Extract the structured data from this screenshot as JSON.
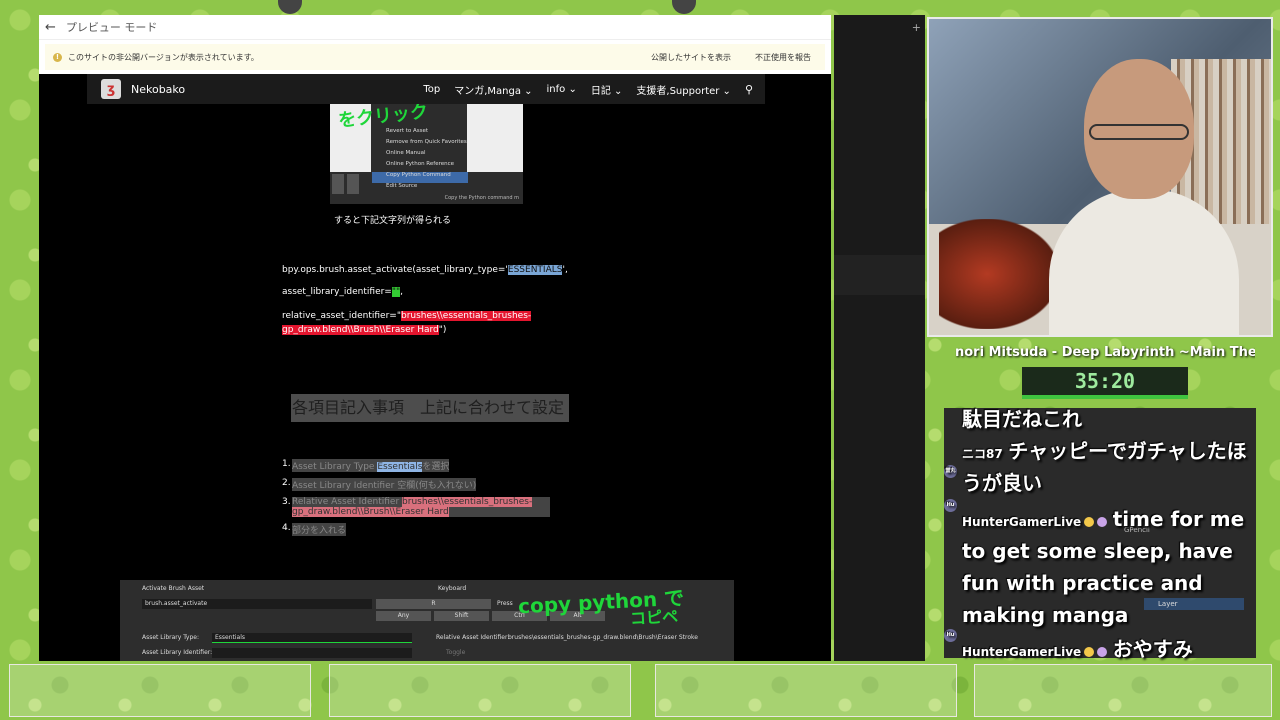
{
  "browser": {
    "preview_label": "プレビュー モード",
    "notice": "このサイトの非公開バージョンが表示されています。",
    "view_published": "公開したサイトを表示",
    "report_abuse": "不正使用を報告"
  },
  "site": {
    "title": "Nekobako",
    "nav": [
      "Top",
      "マンガ,Manga ⌄",
      "info ⌄",
      "日記 ⌄",
      "支援者,Supporter ⌄"
    ]
  },
  "tutorial": {
    "menu_items": [
      "Revert to Asset",
      "Remove from Quick Favorites",
      "Online Manual",
      "Online Python Reference",
      "Copy Python Command",
      "Edit Source"
    ],
    "menu_footer": "Copy the Python command m",
    "handwritten_1": "をクリック",
    "caption": "すると下記文字列が得られる",
    "code_line1_prefix": "bpy.ops.brush.asset_activate(asset_library_type=",
    "code_line1_quote": "'",
    "code_line1_value": "ESSENTIALS",
    "code_line1_suffix": "',",
    "code_line2_prefix": " asset_library_identifier=",
    "code_line2_value": "\"\"",
    "code_line2_suffix": ",",
    "code_line3_prefix": " relative_asset_identifier=\"",
    "code_line3_value": "brushes\\\\essentials_brushes-gp_draw.blend\\\\Brush\\\\Eraser Hard",
    "code_line3_suffix": "\")",
    "section_heading": "各項目記入事項　上記に合わせて設定",
    "steps": [
      {
        "num": "1.",
        "label": "Asset Library Type",
        "value": "Essentials",
        "tail": "を選択"
      },
      {
        "num": "2.",
        "label": "Asset Library Identifier",
        "value": "空欄",
        "tail": "(何も入れない)"
      },
      {
        "num": "3.",
        "label": "Relative Asset Identifier",
        "value": "brushes\\\\essentials_brushes-gp_draw.blend\\\\Brush\\\\Eraser Hard",
        "tail": ""
      },
      {
        "num": "4.",
        "label": "",
        "value": "",
        "tail": "部分を入れる"
      }
    ]
  },
  "blender_panel": {
    "header": "Activate Brush Asset",
    "op_name": "brush.asset_activate",
    "keyboard": "Keyboard",
    "key_r": "R",
    "press": "Press",
    "any": "Any",
    "shift": "Shift",
    "ctrl": "Ctrl",
    "alt": "Alt",
    "lib_type_label": "Asset Library Type:",
    "lib_type_value": "Essentials",
    "lib_id_label": "Asset Library Identifier:",
    "rel_label": "Relative Asset Identifier:",
    "rel_value": "brushes\\essentials_brushes-gp_draw.blend\\Brush\\Eraser Stroke",
    "toggle": "Toggle",
    "handwritten_2": "copy python で",
    "handwritten_3": "コピペ"
  },
  "stream": {
    "song": "nori Mitsuda - Deep Labyrinth ~Main The",
    "timer": "35:20",
    "chat": [
      {
        "user": "",
        "avatar": "",
        "text": "駄目だねこれ"
      },
      {
        "user": "ニコ87",
        "avatar": "雷丸",
        "text": "チャッピーでガチャしたほうが良い"
      },
      {
        "user": "HunterGamerLive",
        "avatar": "Hu",
        "text": "time for me to get some sleep, have fun with practice and making manga"
      },
      {
        "user": "HunterGamerLive",
        "avatar": "Hu",
        "text": "おやすみ"
      }
    ],
    "bg_labels": [
      "GPencil",
      "Layer"
    ]
  }
}
